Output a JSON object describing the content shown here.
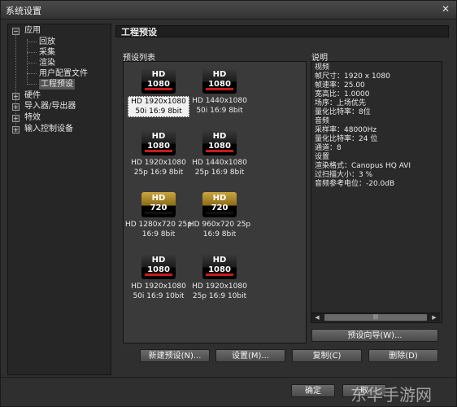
{
  "window": {
    "title": "系统设置"
  },
  "tree": {
    "items": [
      {
        "label": "应用",
        "level": 0,
        "expander": "−"
      },
      {
        "label": "回放",
        "level": 1
      },
      {
        "label": "采集",
        "level": 1
      },
      {
        "label": "渲染",
        "level": 1
      },
      {
        "label": "用户配置文件",
        "level": 1
      },
      {
        "label": "工程预设",
        "level": 1,
        "selected": true
      },
      {
        "label": "硬件",
        "level": 0,
        "expander": "+"
      },
      {
        "label": "导入器/导出器",
        "level": 0,
        "expander": "+"
      },
      {
        "label": "特效",
        "level": 0,
        "expander": "+"
      },
      {
        "label": "输入控制设备",
        "level": 0,
        "expander": "+"
      }
    ]
  },
  "section": {
    "title": "工程预设"
  },
  "presets": {
    "label": "预设列表",
    "tiles": [
      {
        "hd": "HD",
        "res": "1080",
        "line1": "HD 1920x1080",
        "line2": "50i 16:9 8bit",
        "selected": true
      },
      {
        "hd": "HD",
        "res": "1080",
        "line1": "HD 1440x1080",
        "line2": "50i 16:9 8bit"
      },
      {
        "hd": "HD",
        "res": "1080",
        "line1": "HD 1920x1080",
        "line2": "25p 16:9 8bit"
      },
      {
        "hd": "HD",
        "res": "1080",
        "line1": "HD 1440x1080",
        "line2": "25p 16:9 8bit"
      },
      {
        "hd": "HD",
        "res": "720",
        "line1": "HD 1280x720 25p",
        "line2": "16:9 8bit"
      },
      {
        "hd": "HD",
        "res": "720",
        "line1": "HD 960x720 25p",
        "line2": "16:9 8bit"
      },
      {
        "hd": "HD",
        "res": "1080",
        "line1": "HD 1920x1080",
        "line2": "50i 16:9 10bit"
      },
      {
        "hd": "HD",
        "res": "1080",
        "line1": "HD 1920x1080",
        "line2": "25p 16:9 10bit"
      }
    ]
  },
  "description": {
    "label": "说明",
    "lines": [
      "视频",
      " 帧尺寸：1920 x 1080",
      " 帧速率：25.00",
      "宽高比：1.0000",
      " 场序：上场优先",
      "量化比特率：8位",
      "音频",
      "采样率：48000Hz",
      "量化比特率：24 位",
      " 通道：8",
      "设置",
      " 渲染格式：Canopus HQ AVI",
      " 过扫描大小：3 %",
      " 音频参考电位：-20.0dB"
    ]
  },
  "buttons": {
    "wizard": "预设向导(W)...",
    "new_preset": "新建预设(N)...",
    "settings": "设置(M)...",
    "copy": "复制(C)",
    "delete": "删除(D)",
    "ok": "确定",
    "cancel": "取"
  },
  "watermark": "东华手游网",
  "colors": {
    "bar_red": "#c81a1a",
    "badge_gold": "#caa640"
  }
}
